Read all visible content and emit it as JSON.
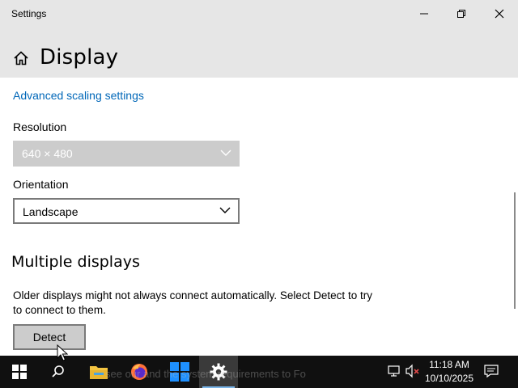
{
  "window": {
    "title": "Settings",
    "controls": [
      "minimize",
      "restore",
      "close"
    ]
  },
  "header": {
    "page_title": "Display",
    "home_icon": "home-icon"
  },
  "content": {
    "advanced_link": "Advanced scaling settings",
    "resolution": {
      "label": "Resolution",
      "value": "640 × 480",
      "disabled": true
    },
    "orientation": {
      "label": "Orientation",
      "value": "Landscape"
    },
    "multiple_displays": {
      "title": "Multiple displays",
      "description": "Older displays might not always connect automatically. Select Detect to try to connect to them.",
      "detect_label": "Detect"
    }
  },
  "taskbar": {
    "ghost_text": "see our         and the system requirements to          Fo",
    "clock_time": "11:18 AM",
    "clock_date": "10/10/2025",
    "items": [
      "start-icon",
      "search-icon",
      "file-explorer-icon",
      "firefox-icon",
      "windows-app-icon",
      "settings-icon"
    ]
  },
  "colors": {
    "accent_link": "#0067b8",
    "titlebar_bg": "#e6e6e6",
    "taskbar_bg": "#101010",
    "disabled_dropdown_bg": "#cccccc"
  }
}
